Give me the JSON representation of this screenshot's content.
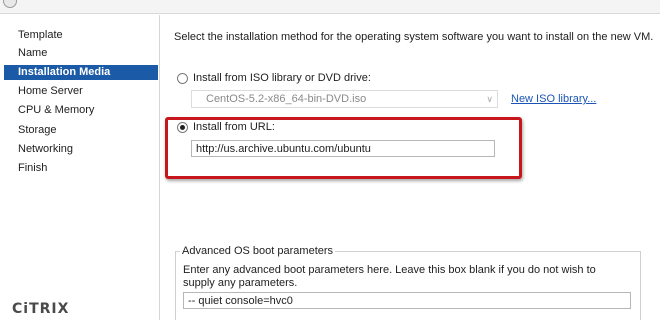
{
  "wizard": {
    "nav": [
      "Template",
      "Name",
      "Installation Media",
      "Home Server",
      "CPU & Memory",
      "Storage",
      "Networking",
      "Finish"
    ],
    "active_step": "Installation Media",
    "logo_text": "CiTRIX"
  },
  "main": {
    "intro": "Select the installation method for the operating system software you want to install on the new VM.",
    "iso_option": {
      "label": "Install from ISO library or DVD drive:",
      "selected": false,
      "select_value": "CentOS-5.2-x86_64-bin-DVD.iso",
      "link": "New ISO library..."
    },
    "url_option": {
      "label": "Install from URL:",
      "selected": true,
      "value": "http://us.archive.ubuntu.com/ubuntu"
    },
    "boot_params": {
      "title": "Advanced OS boot parameters",
      "description": "Enter any advanced boot parameters here. Leave this box blank if you do not wish to supply any parameters.",
      "value": "-- quiet console=hvc0"
    }
  },
  "colors": {
    "active_nav": "#1b5aa6",
    "highlight_border": "#c8161d",
    "link": "#1a55b5"
  }
}
